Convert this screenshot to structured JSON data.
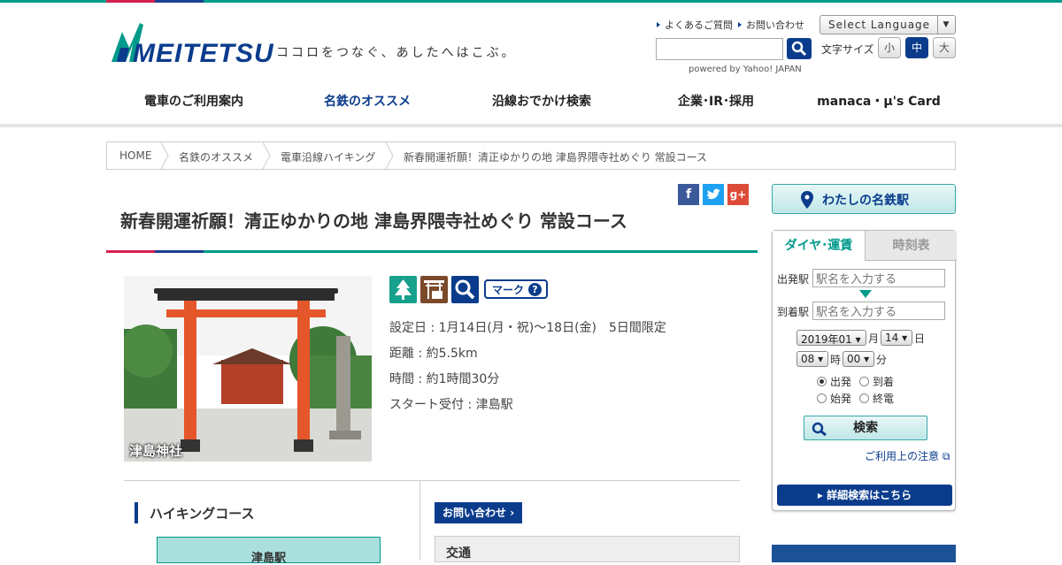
{
  "header": {
    "logo_text": "MEITETSU",
    "tagline": "ココロをつなぐ、あしたへはこぶ。",
    "faq_link": "よくあるご質問",
    "contact_link": "お問い合わせ",
    "language_select": "Select Language",
    "search_placeholder": "",
    "powered_by": "powered by Yahoo! JAPAN",
    "font_size_label": "文字サイズ",
    "font_sizes": [
      "小",
      "中",
      "大"
    ],
    "font_size_selected": "中"
  },
  "global_nav": {
    "items": [
      "電車のご利用案内",
      "名鉄のオススメ",
      "沿線おでかけ検索",
      "企業･IR･採用",
      "manaca・μ's Card"
    ],
    "active": "名鉄のオススメ"
  },
  "breadcrumb": [
    "HOME",
    "名鉄のオススメ",
    "電車沿線ハイキング",
    "新春開運祈願！清正ゆかりの地 津島界隈寺社めぐり 常設コース"
  ],
  "article": {
    "title": "新春開運祈願！清正ゆかりの地 津島界隈寺社めぐり 常設コース",
    "photo_caption": "津島神社",
    "mark_label": "マーク",
    "info": {
      "date": "設定日 : 1月14日(月・祝)～18日(金)　5日間限定",
      "distance": "距離 : 約5.5km",
      "time": "時間 : 約1時間30分",
      "start": "スタート受付 : 津島駅"
    },
    "hiking_course_heading": "ハイキングコース",
    "first_station": "津島駅",
    "inquiry_button": "お問い合わせ",
    "traffic_heading": "交通"
  },
  "sidebar": {
    "my_station": "わたしの名鉄駅",
    "tabs": [
      "ダイヤ･運賃",
      "時刻表"
    ],
    "depart_label": "出発駅",
    "arrive_label": "到着駅",
    "depart_placeholder": "駅名を入力する",
    "arrive_placeholder": "駅名を入力する",
    "year_month": "2019年01",
    "month_unit": "月",
    "day": "14",
    "day_unit": "日",
    "hour": "08",
    "hour_unit": "時",
    "minute": "00",
    "minute_unit": "分",
    "radio_options": [
      "出発",
      "到着",
      "始発",
      "終電"
    ],
    "radio_selected": "出発",
    "search_button": "検索",
    "usage_note": "ご利用上の注意",
    "detail_search": "詳細検索はこちら"
  },
  "colors": {
    "brand_navy": "#0b3c8c",
    "brand_teal": "#009a8a",
    "brand_red": "#d6204e",
    "torii": "#e5562b"
  }
}
